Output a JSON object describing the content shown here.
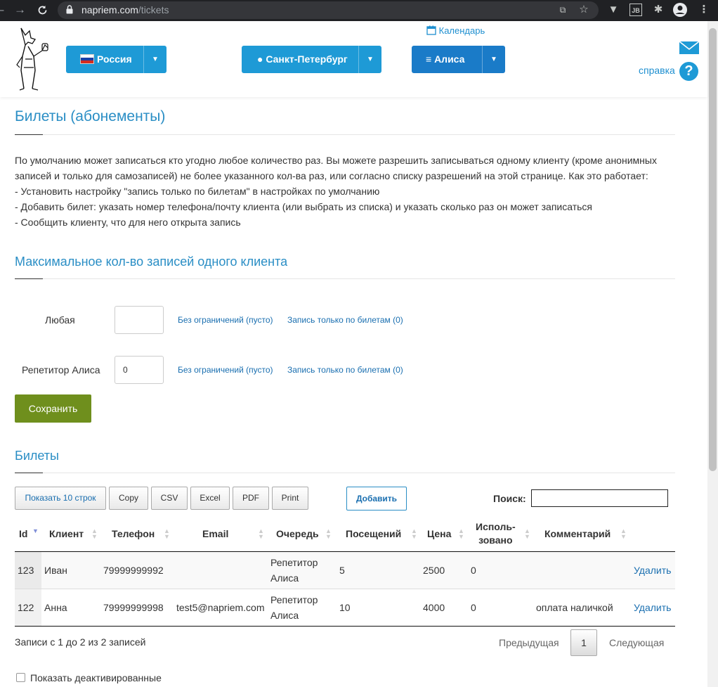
{
  "browser": {
    "url_domain": "napriem.com",
    "url_path": "/tickets"
  },
  "header": {
    "country": "Россия",
    "city": "Санкт-Петербург",
    "user": "Алиса",
    "calendar": "Календарь",
    "help": "справка",
    "help_icon_glyph": "?"
  },
  "page": {
    "title": "Билеты (абонементы)",
    "intro": [
      "По умолчанию может записаться кто угодно любое количество раз. Вы можете разрешить записываться одному клиенту (кроме анонимных записей и только для самозаписей) не более указанного кол-ва раз, или согласно списку разрешений на этой странице. Как это работает:",
      "- Установить настройку \"запись только по билетам\" в настройках по умолчанию",
      "- Добавить билет: указать номер телефона/почту клиента (или выбрать из списка) и указать сколько раз он может записаться",
      "- Сообщить клиенту, что для него открыта запись"
    ]
  },
  "max_section": {
    "title": "Максимальное кол-во записей одного клиента",
    "rows": [
      {
        "label": "Любая",
        "value": "",
        "link_unlimited": "Без ограничений (пусто)",
        "link_tickets": "Запись только по билетам (0)"
      },
      {
        "label": "Репетитор Алиса",
        "value": "0",
        "link_unlimited": "Без ограничений (пусто)",
        "link_tickets": "Запись только по билетам (0)"
      }
    ],
    "save": "Сохранить"
  },
  "tickets": {
    "title": "Билеты",
    "buttons": {
      "show_rows": "Показать 10 строк",
      "copy": "Copy",
      "csv": "CSV",
      "excel": "Excel",
      "pdf": "PDF",
      "print": "Print",
      "add": "Добавить"
    },
    "search_label": "Поиск:",
    "search_value": "",
    "columns": {
      "id": "Id",
      "client": "Клиент",
      "phone": "Телефон",
      "email": "Email",
      "queue": "Очередь",
      "visits": "Посещений",
      "price": "Цена",
      "used_1": "Исполь-",
      "used_2": "зовано",
      "comment": "Комментарий"
    },
    "rows": [
      {
        "id": "123",
        "client": "Иван",
        "phone": "79999999992",
        "email": "",
        "queue_1": "Репетитор",
        "queue_2": "Алиса",
        "visits": "5",
        "price": "2500",
        "used": "0",
        "comment": "",
        "action": "Удалить"
      },
      {
        "id": "122",
        "client": "Анна",
        "phone": "79999999998",
        "email": "test5@napriem.com",
        "queue_1": "Репетитор",
        "queue_2": "Алиса",
        "visits": "10",
        "price": "4000",
        "used": "0",
        "comment": "оплата наличкой",
        "action": "Удалить"
      }
    ],
    "info": "Записи с 1 до 2 из 2 записей",
    "prev": "Предыдущая",
    "current_page": "1",
    "next": "Следующая"
  },
  "show_deactivated": "Показать деактивированные"
}
